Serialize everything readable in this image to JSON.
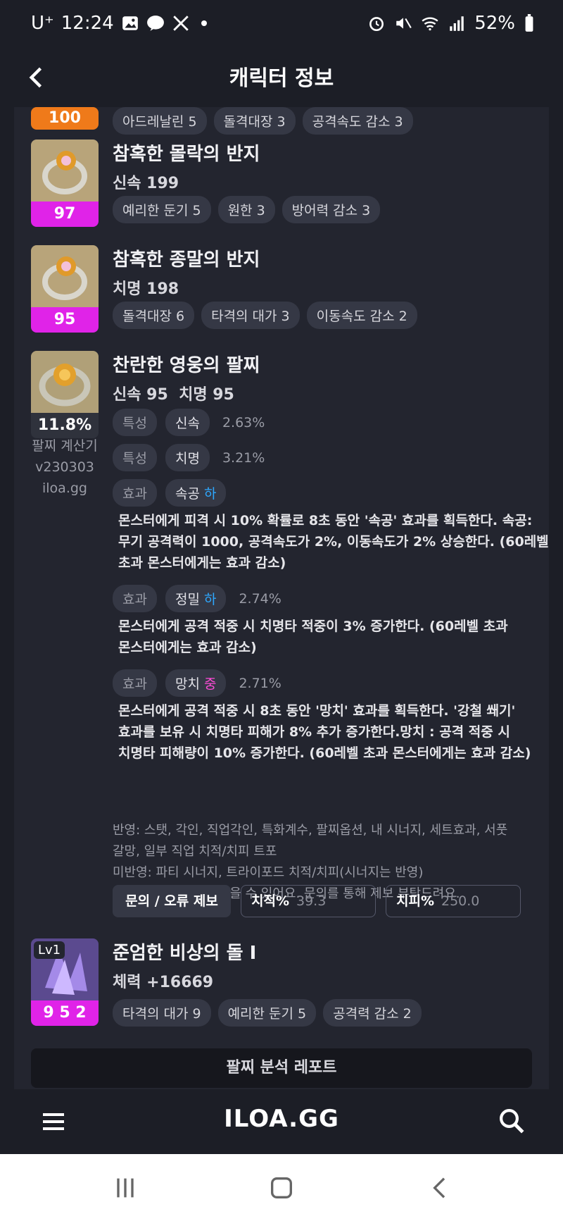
{
  "status_bar": {
    "carrier": "U⁺",
    "time": "12:24",
    "battery": "52%"
  },
  "app_bar": {
    "title": "캐릭터 정보"
  },
  "partial_item": {
    "level": "100",
    "chips": [
      "아드레날린 5",
      "돌격대장 3",
      "공격속도 감소 3"
    ]
  },
  "items": [
    {
      "name": "참혹한 몰락의 반지",
      "stat": "신속 199",
      "level": "97",
      "chips": [
        "예리한 둔기 5",
        "원한 3",
        "방어력 감소 3"
      ]
    },
    {
      "name": "참혹한 종말의 반지",
      "stat": "치명 198",
      "level": "95",
      "chips": [
        "돌격대장 6",
        "타격의 대가 3",
        "이동속도 감소 2"
      ]
    }
  ],
  "bracelet": {
    "name": "찬란한 영웅의 팔찌",
    "stat": "신속 95  치명 95",
    "percent": "11.8%",
    "calc_label_1": "팔찌 계산기",
    "calc_label_2": "v230303",
    "calc_label_3": "iloa.gg",
    "traits": [
      {
        "tag": "특성",
        "name": "신속",
        "pct": "2.63%"
      },
      {
        "tag": "특성",
        "name": "치명",
        "pct": "3.21%"
      }
    ],
    "effects": [
      {
        "tag": "효과",
        "name": "속공",
        "tier": "하",
        "pct": "",
        "desc_1": "몬스터에게 피격 시 10% 확률로 8초 동안 '속공' 효과를 획득한다. 속공:",
        "desc_2": "무기 공격력이 1000, 공격속도가 2%, 이동속도가 2% 상승한다. (60레벨",
        "desc_3": "초과 몬스터에게는 효과 감소)"
      },
      {
        "tag": "효과",
        "name": "정밀",
        "tier": "하",
        "pct": "2.74%",
        "desc_1": "몬스터에게 공격 적중 시 치명타 적중이 3% 증가한다. (60레벨 초과",
        "desc_2": "몬스터에게는 효과 감소)"
      },
      {
        "tag": "효과",
        "name": "망치",
        "tier": "중",
        "pct": "2.71%",
        "desc_1": "몬스터에게 공격 적중 시 8초 동안 '망치' 효과를 획득한다. '강철 쐐기'",
        "desc_2": "효과를 보유 시 치명타 피해가 8% 추가 증가한다.망치 : 공격 적중 시",
        "desc_3": "치명타 피해량이 10% 증가한다. (60레벨 초과 몬스터에게는 효과 감소)"
      }
    ],
    "notes": [
      "반영: 스탯, 각인, 직업각인, 특화계수, 팔찌옵션, 내 시너지, 세트효과, 서풋",
      "갈망, 일부 직업 치적/치피 트포",
      "미반영: 파티 시너지, 트라이포드 치적/치피(시너지는 반영)",
      "일부 수식에 오류가 있을 수 있어요. 문의를 통해 제보 부탁드려요."
    ],
    "report_button": "문의 / 오류 제보",
    "crit_rate_label": "치적%",
    "crit_rate_value": "39.3",
    "crit_dmg_label": "치피%",
    "crit_dmg_value": "250.0"
  },
  "stone": {
    "name": "준엄한 비상의 돌 I",
    "stat": "체력 +16669",
    "badge": "Lv1",
    "level": "9 5 2",
    "chips": [
      "타격의 대가 9",
      "예리한 둔기 5",
      "공격력 감소 2"
    ]
  },
  "report_bar": "팔찌 분석 레포트",
  "bottom_nav": {
    "logo": "ILOA.GG"
  }
}
